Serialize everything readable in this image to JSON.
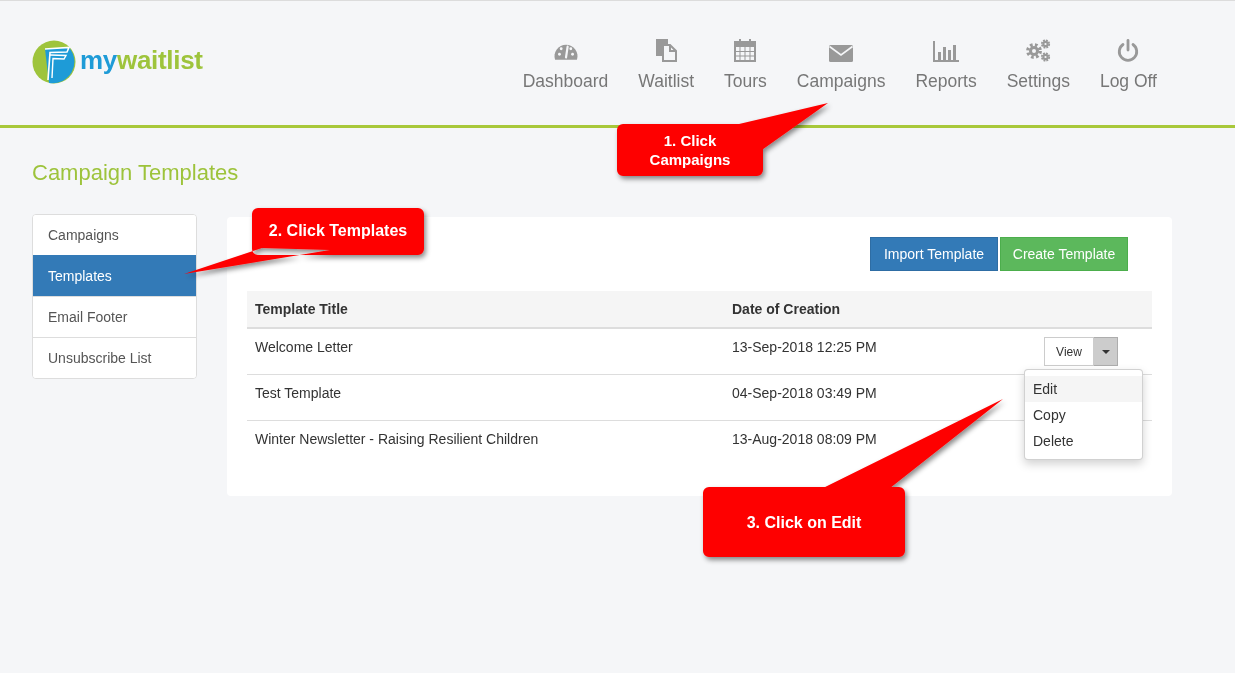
{
  "header": {
    "logo": {
      "prefix": "my",
      "suffix": "waitlist"
    },
    "nav": [
      {
        "label": "Dashboard"
      },
      {
        "label": "Waitlist"
      },
      {
        "label": "Tours"
      },
      {
        "label": "Campaigns"
      },
      {
        "label": "Reports"
      },
      {
        "label": "Settings"
      },
      {
        "label": "Log Off"
      }
    ]
  },
  "page": {
    "title": "Campaign Templates"
  },
  "sidebar": {
    "items": [
      {
        "label": "Campaigns",
        "selected": false
      },
      {
        "label": "Templates",
        "selected": true
      },
      {
        "label": "Email Footer",
        "selected": false
      },
      {
        "label": "Unsubscribe List",
        "selected": false
      }
    ]
  },
  "toolbar": {
    "buttons": [
      {
        "label": "Import Template",
        "kind": "primary"
      },
      {
        "label": "Create Template",
        "kind": "success"
      }
    ]
  },
  "table": {
    "columns": [
      "Template Title",
      "Date of Creation"
    ],
    "rows": [
      {
        "title": "Welcome Letter",
        "created": "13-Sep-2018 12:25 PM",
        "action": {
          "label": "View",
          "expanded": true,
          "menu": [
            {
              "label": "Edit",
              "selected": true
            },
            {
              "label": "Copy",
              "selected": false
            },
            {
              "label": "Delete",
              "selected": false
            }
          ]
        }
      },
      {
        "title": "Test Template",
        "created": "04-Sep-2018 03:49 PM"
      },
      {
        "title": "Winter Newsletter - Raising Resilient Children",
        "created": "13-Aug-2018 08:09 PM"
      }
    ]
  },
  "annotations": [
    {
      "text": "1. Click Campaigns"
    },
    {
      "text": "2. Click Templates"
    },
    {
      "text": "3. Click on Edit"
    }
  ]
}
